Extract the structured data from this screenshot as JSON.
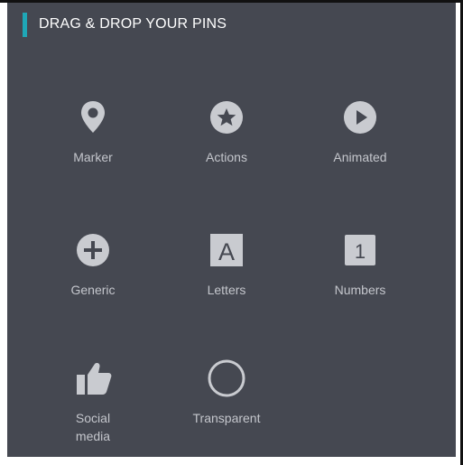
{
  "header": {
    "title": "DRAG & DROP YOUR PINS",
    "accent_color": "#1fa7b6"
  },
  "pins": [
    {
      "label": "Marker",
      "icon": "map-marker-icon"
    },
    {
      "label": "Actions",
      "icon": "star-circle-icon"
    },
    {
      "label": "Animated",
      "icon": "play-circle-icon"
    },
    {
      "label": "Generic",
      "icon": "plus-circle-icon"
    },
    {
      "label": "Letters",
      "icon": "letter-a-box-icon",
      "glyph": "A"
    },
    {
      "label": "Numbers",
      "icon": "number-1-box-icon",
      "glyph": "1"
    },
    {
      "label": "Social media",
      "icon": "thumbs-up-icon"
    },
    {
      "label": "Transparent",
      "icon": "ring-icon"
    }
  ],
  "colors": {
    "panel_background": "#454851",
    "icon_color": "#c9cbd0",
    "label_color": "#c4c6cc"
  }
}
